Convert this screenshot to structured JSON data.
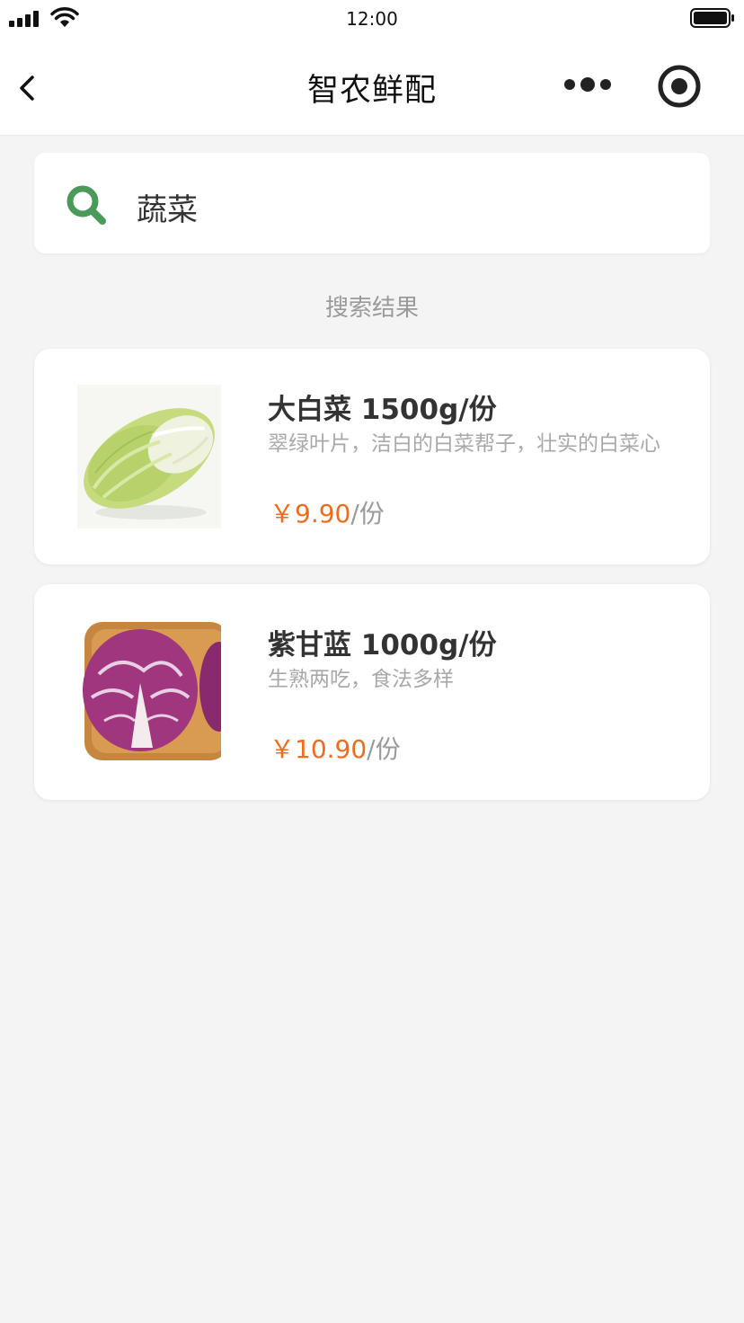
{
  "status_bar": {
    "time": "12:00"
  },
  "nav": {
    "title": "智农鲜配"
  },
  "search": {
    "query": "蔬菜"
  },
  "section_title": "搜索结果",
  "colors": {
    "accent_green": "#4a9a5a",
    "price_orange": "#f26a1b"
  },
  "products": [
    {
      "name": "大白菜 1500g/份",
      "desc": "翠绿叶片，洁白的白菜帮子，壮实的白菜心",
      "price": "￥9.90",
      "unit": "/份",
      "image": "napa-cabbage"
    },
    {
      "name": "紫甘蓝 1000g/份",
      "desc": "生熟两吃，食法多样",
      "price": "￥10.90",
      "unit": "/份",
      "image": "red-cabbage"
    }
  ]
}
